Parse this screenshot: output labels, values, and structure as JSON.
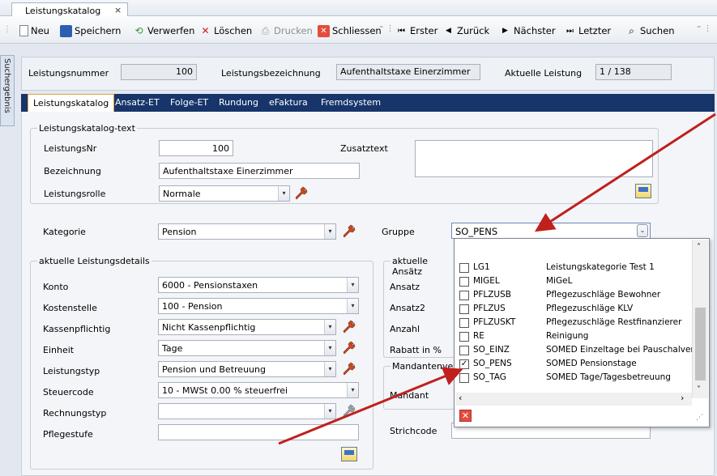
{
  "document_tab": {
    "title": "Leistungskatalog",
    "close": "×"
  },
  "toolbar": {
    "new": "Neu",
    "save": "Speichern",
    "discard": "Verwerfen",
    "delete": "Löschen",
    "print": "Drucken",
    "close": "Schliessen",
    "first": "Erster",
    "back": "Zurück",
    "next": "Nächster",
    "last": "Letzter",
    "search": "Suchen"
  },
  "side_panel": {
    "label": "Suchergebnis"
  },
  "header": {
    "number_label": "Leistungsnummer",
    "number_value": "100",
    "name_label": "Leistungsbezeichnung",
    "name_value": "Aufenthaltstaxe Einerzimmer",
    "current_label": "Aktuelle Leistung",
    "current_value": "1 / 138"
  },
  "tabs": [
    "Leistungskatalog",
    "Ansatz-ET",
    "Folge-ET",
    "Rundung",
    "eFaktura",
    "Fremdsystem"
  ],
  "catalog_text": {
    "title": "Leistungskatalog-text",
    "nr_label": "LeistungsNr",
    "nr_value": "100",
    "desc_label": "Bezeichnung",
    "desc_value": "Aufenthaltstaxe Einerzimmer",
    "role_label": "Leistungsrolle",
    "role_value": "Normale",
    "extra_label": "Zusatztext"
  },
  "category": {
    "label": "Kategorie",
    "value": "Pension"
  },
  "group": {
    "label": "Gruppe",
    "value": "SO_PENS"
  },
  "details": {
    "title": "aktuelle Leistungsdetails",
    "rows": [
      {
        "label": "Konto",
        "value": "6000 - Pensionstaxen"
      },
      {
        "label": "Kostenstelle",
        "value": "100 - Pension"
      },
      {
        "label": "Kassenpflichtig",
        "value": "Nicht Kassenpflichtig"
      },
      {
        "label": "Einheit",
        "value": "Tage"
      },
      {
        "label": "Leistungstyp",
        "value": "Pension und Betreuung"
      },
      {
        "label": "Steuercode",
        "value": "10 - MWSt  0.00 %  steuerfrei"
      },
      {
        "label": "Rechnungstyp",
        "value": ""
      },
      {
        "label": "Pflegestufe",
        "value": ""
      }
    ]
  },
  "approach": {
    "title": "aktuelle Ansätz",
    "labels": [
      "Ansatz",
      "Ansatz2",
      "Anzahl",
      "Rabatt in %"
    ]
  },
  "client": {
    "title": "Mandantenverw",
    "label": "Mandant"
  },
  "barcode": {
    "label": "Strichcode"
  },
  "popup": {
    "items": [
      {
        "code": "LG1",
        "desc": "Leistungskategorie Test 1",
        "checked": false
      },
      {
        "code": "MIGEL",
        "desc": "MiGeL",
        "checked": false
      },
      {
        "code": "PFLZUSB",
        "desc": "Pflegezuschläge Bewohner",
        "checked": false
      },
      {
        "code": "PFLZUS",
        "desc": "Pflegezuschläge KLV",
        "checked": false
      },
      {
        "code": "PFLZUSKT",
        "desc": "Pflegezuschläge Restfinanzierer",
        "checked": false
      },
      {
        "code": "RE",
        "desc": "Reinigung",
        "checked": false
      },
      {
        "code": "SO_EINZ",
        "desc": "SOMED Einzeltage bei Pauschalverr.",
        "checked": false
      },
      {
        "code": "SO_PENS",
        "desc": "SOMED Pensionstage",
        "checked": true
      },
      {
        "code": "SO_TAG",
        "desc": "SOMED Tage/Tagesbetreuung",
        "checked": false
      }
    ],
    "check_mark": "✓"
  },
  "colors": {
    "tab_bar": "#17356a",
    "arrow": "#c0201c",
    "close_red": "#e64b3c"
  },
  "icons": [
    "new-icon",
    "save-icon",
    "discard-icon",
    "delete-icon",
    "print-icon",
    "close-icon",
    "first-icon",
    "back-icon",
    "next-icon",
    "last-icon",
    "search-icon",
    "wrench-icon",
    "calendar-icon"
  ]
}
